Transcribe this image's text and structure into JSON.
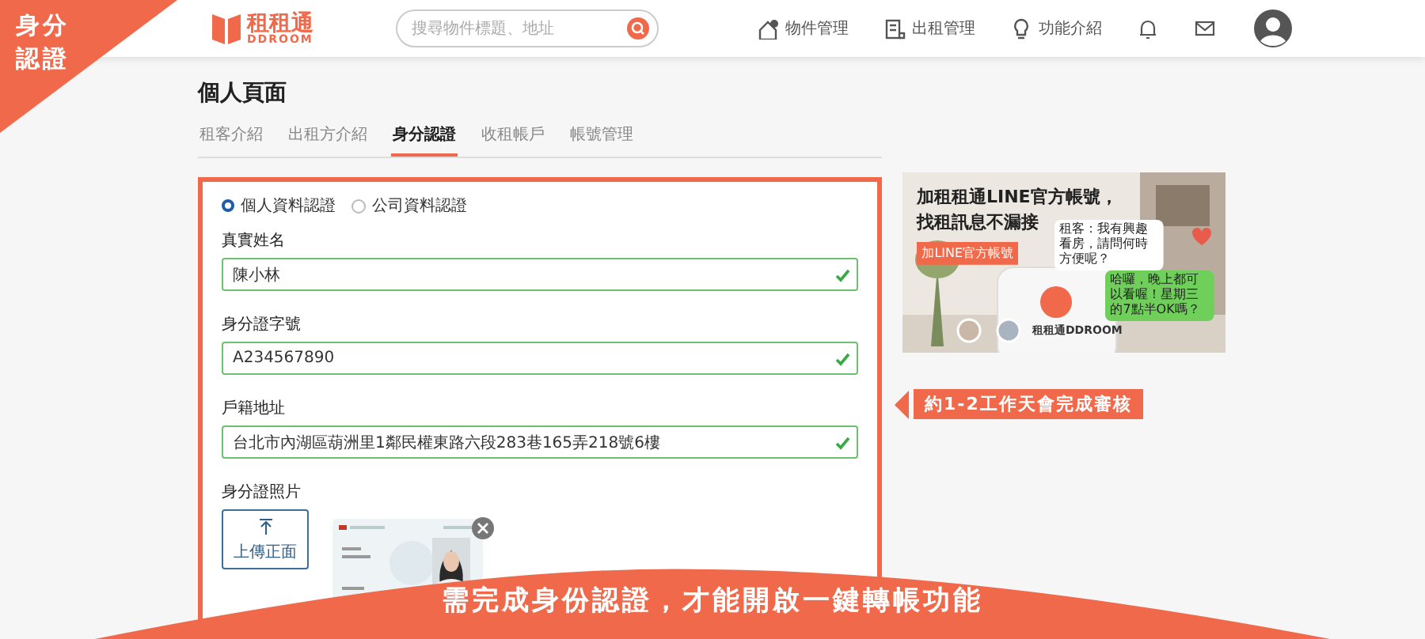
{
  "corner_badge": "身分認證",
  "header": {
    "logo": {
      "name": "租租通",
      "subtitle": "DDROOM"
    },
    "search": {
      "placeholder": "搜尋物件標題、地址"
    },
    "nav": [
      {
        "label": "物件管理"
      },
      {
        "label": "出租管理"
      },
      {
        "label": "功能介紹"
      }
    ]
  },
  "page": {
    "title": "個人頁面",
    "tabs": [
      {
        "label": "租客介紹",
        "selected": false
      },
      {
        "label": "出租方介紹",
        "selected": false
      },
      {
        "label": "身分認證",
        "selected": true
      },
      {
        "label": "收租帳戶",
        "selected": false
      },
      {
        "label": "帳號管理",
        "selected": false
      }
    ]
  },
  "form": {
    "radios": [
      {
        "label": "個人資料認證",
        "selected": true
      },
      {
        "label": "公司資料認證",
        "selected": false
      }
    ],
    "fields": [
      {
        "label": "真實姓名",
        "value": "陳小林",
        "valid": true
      },
      {
        "label": "身分證字號",
        "value": "A234567890",
        "valid": true
      },
      {
        "label": "戶籍地址",
        "value": "台北市內湖區葫洲里1鄰民權東路六段283巷165弄218號6樓",
        "valid": true
      }
    ],
    "photo_label": "身分證照片",
    "upload_button": "上傳正面"
  },
  "promo": {
    "headline": "加租租通LINE官方帳號，",
    "headline_2": "找租訊息不漏接",
    "button": "加LINE官方帳號",
    "bubbles": [
      {
        "text": "租客：我有興趣看房，請問何時方便呢？",
        "kind": "incoming"
      },
      {
        "text": "哈囉，晚上都可以看喔！星期三的7點半OK嗎？",
        "kind": "outgoing"
      }
    ],
    "account": "租租通DDROOM"
  },
  "review_note": "約1-2工作天會完成審核",
  "bottom_banner": "需完成身份認證，才能開啟一鍵轉帳功能"
}
